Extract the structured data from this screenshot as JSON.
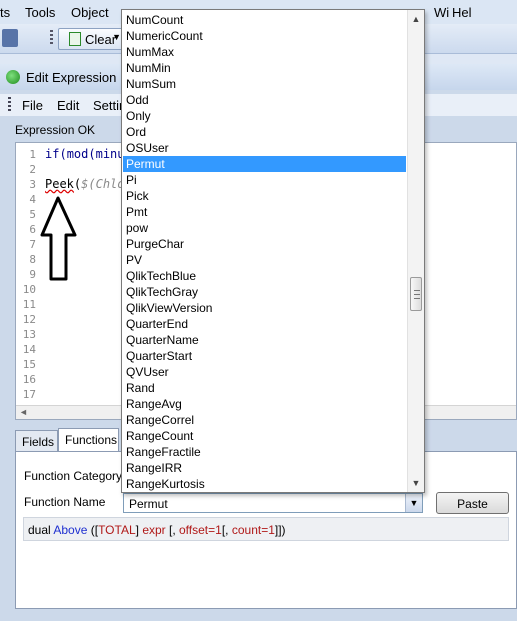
{
  "app_menu": [
    "ts",
    "Tools",
    "Object",
    "Wi",
    "Hel"
  ],
  "toolbar": {
    "clear_label": "Clear"
  },
  "dialog": {
    "title": "Edit Expression",
    "menu": [
      "File",
      "Edit",
      "Settin"
    ],
    "status": "Expression OK"
  },
  "editor": {
    "line_numbers": [
      "1",
      "2",
      "3",
      "4",
      "5",
      "6",
      "7",
      "8",
      "9",
      "10",
      "11",
      "12",
      "13",
      "14",
      "15",
      "16",
      "17"
    ],
    "line1_kw": "if(",
    "line1_fn": "mod",
    "line1_rest": "(minut",
    "line3_fn": "Peek",
    "line3_paren": "(",
    "line3_arg": "$(Chlo"
  },
  "tabs": [
    "Fields",
    "Functions"
  ],
  "panel": {
    "category_label": "Function Category",
    "name_label": "Function Name",
    "name_value": "Permut",
    "paste_label": "Paste",
    "syntax": {
      "p1": "dual ",
      "p2": "Above",
      "p3": " ([",
      "p4": "TOTAL",
      "p5": "] ",
      "p6": "expr",
      "p7": " [, ",
      "p8": "offset=1",
      "p9": "[, ",
      "p10": "count=1",
      "p11": "]])"
    }
  },
  "dropdown": {
    "items": [
      "NumCount",
      "NumericCount",
      "NumMax",
      "NumMin",
      "NumSum",
      "Odd",
      "Only",
      "Ord",
      "OSUser",
      "Permut",
      "Pi",
      "Pick",
      "Pmt",
      "pow",
      "PurgeChar",
      "PV",
      "QlikTechBlue",
      "QlikTechGray",
      "QlikViewVersion",
      "QuarterEnd",
      "QuarterName",
      "QuarterStart",
      "QVUser",
      "Rand",
      "RangeAvg",
      "RangeCorrel",
      "RangeCount",
      "RangeFractile",
      "RangeIRR",
      "RangeKurtosis"
    ],
    "selected": "Permut"
  },
  "colors": {
    "selection": "#3399ff",
    "keyword": "#00008b",
    "syntax_blue": "#1e2fd0",
    "syntax_red": "#b01818"
  }
}
